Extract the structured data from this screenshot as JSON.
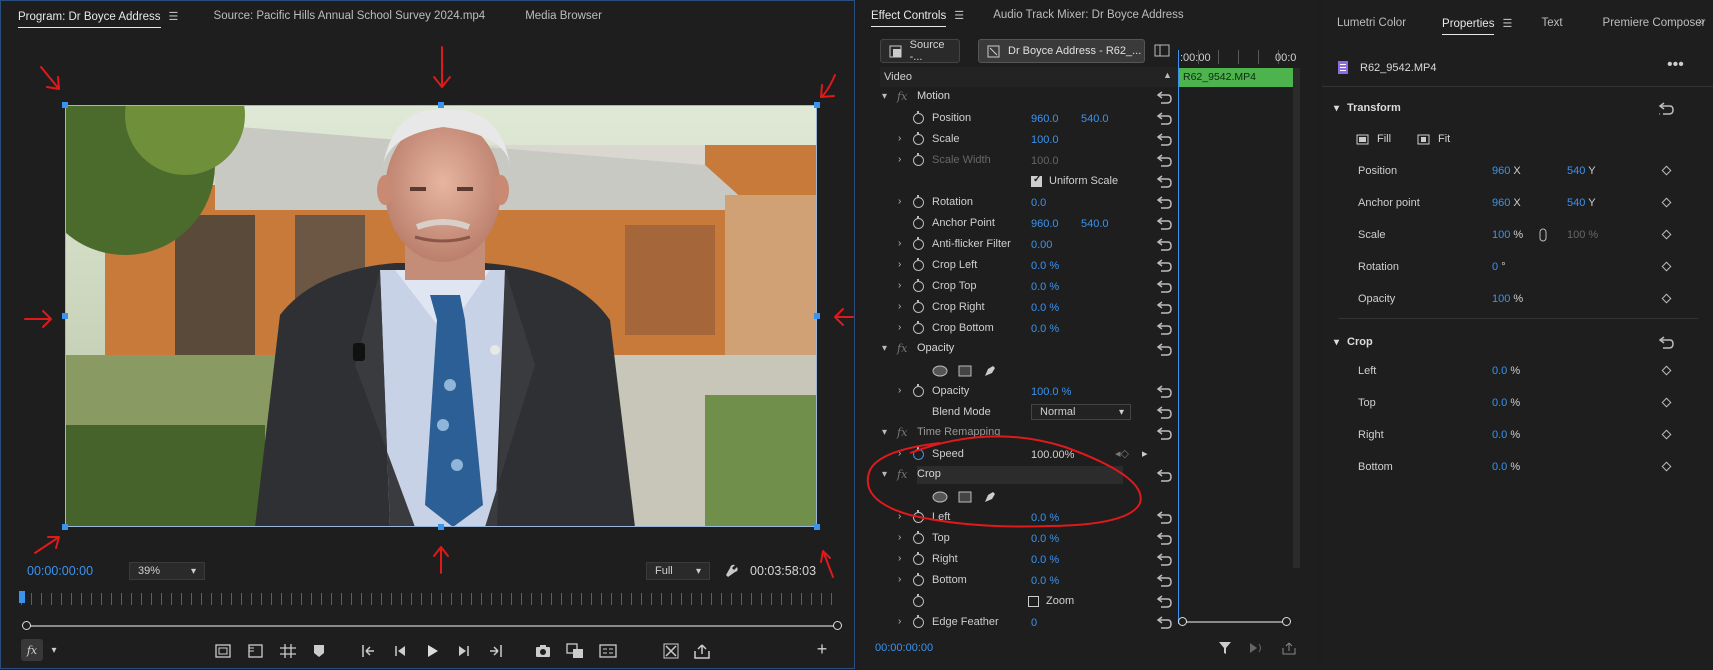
{
  "program": {
    "tabs": [
      "Program: Dr Boyce Address",
      "Source: Pacific Hills Annual School Survey 2024.mp4",
      "Media Browser"
    ],
    "timecode": "00:00:00:00",
    "zoom": "39%",
    "quality": "Full",
    "duration": "00:03:58:03"
  },
  "effect_controls": {
    "tabs": [
      "Effect Controls",
      "Audio Track Mixer: Dr Boyce Address"
    ],
    "source_btn": "Source -...",
    "clip_btn": "Dr Boyce Address - R62_...",
    "ruler_start": ":00:00",
    "ruler_end": "00:0",
    "clip_name": "R62_9542.MP4",
    "section": "Video",
    "timecode": "00:00:00:00",
    "rows": {
      "motion": "Motion",
      "position": "Position",
      "position_x": "960.0",
      "position_y": "540.0",
      "scale": "Scale",
      "scale_val": "100.0",
      "scale_width": "Scale Width",
      "scale_width_val": "100.0",
      "uniform_scale": "Uniform Scale",
      "rotation": "Rotation",
      "rotation_val": "0.0",
      "anchor": "Anchor Point",
      "anchor_x": "960.0",
      "anchor_y": "540.0",
      "antiflicker": "Anti-flicker Filter",
      "antiflicker_val": "0.00",
      "crop_left": "Crop Left",
      "crop_left_val": "0.0 %",
      "crop_top": "Crop Top",
      "crop_top_val": "0.0 %",
      "crop_right": "Crop Right",
      "crop_right_val": "0.0 %",
      "crop_bottom": "Crop Bottom",
      "crop_bottom_val": "0.0 %",
      "opacity_fx": "Opacity",
      "opacity": "Opacity",
      "opacity_val": "100.0 %",
      "blend": "Blend Mode",
      "blend_val": "Normal",
      "time_remap": "Time Remapping",
      "speed": "Speed",
      "speed_val": "100.00%",
      "crop_fx": "Crop",
      "left": "Left",
      "left_val": "0.0 %",
      "top": "Top",
      "top_val": "0.0 %",
      "right": "Right",
      "right_val": "0.0 %",
      "bottom": "Bottom",
      "bottom_val": "0.0 %",
      "zoom": "Zoom",
      "edge": "Edge Feather",
      "edge_val": "0"
    }
  },
  "properties": {
    "tabs": [
      "Lumetri Color",
      "Properties",
      "Text",
      "Premiere Composer"
    ],
    "clip": "R62_9542.MP4",
    "transform": "Transform",
    "fill": "Fill",
    "fit": "Fit",
    "position": "Position",
    "position_x": "960",
    "position_y": "540",
    "anchor": "Anchor point",
    "anchor_x": "960",
    "anchor_y": "540",
    "scale": "Scale",
    "scale_val": "100",
    "scale_val2": "100 %",
    "rotation": "Rotation",
    "rotation_val": "0",
    "opacity": "Opacity",
    "opacity_val": "100",
    "crop": "Crop",
    "left": "Left",
    "left_val": "0.0",
    "top": "Top",
    "top_val": "0.0",
    "right": "Right",
    "right_val": "0.0",
    "bottom": "Bottom",
    "bottom_val": "0.0",
    "unit_x": "X",
    "unit_y": "Y",
    "unit_pct": "%",
    "unit_deg": "°"
  },
  "colors": {
    "accent": "#3b93f0",
    "clip_green": "#4db34d",
    "annotation_red": "#e0191b"
  }
}
